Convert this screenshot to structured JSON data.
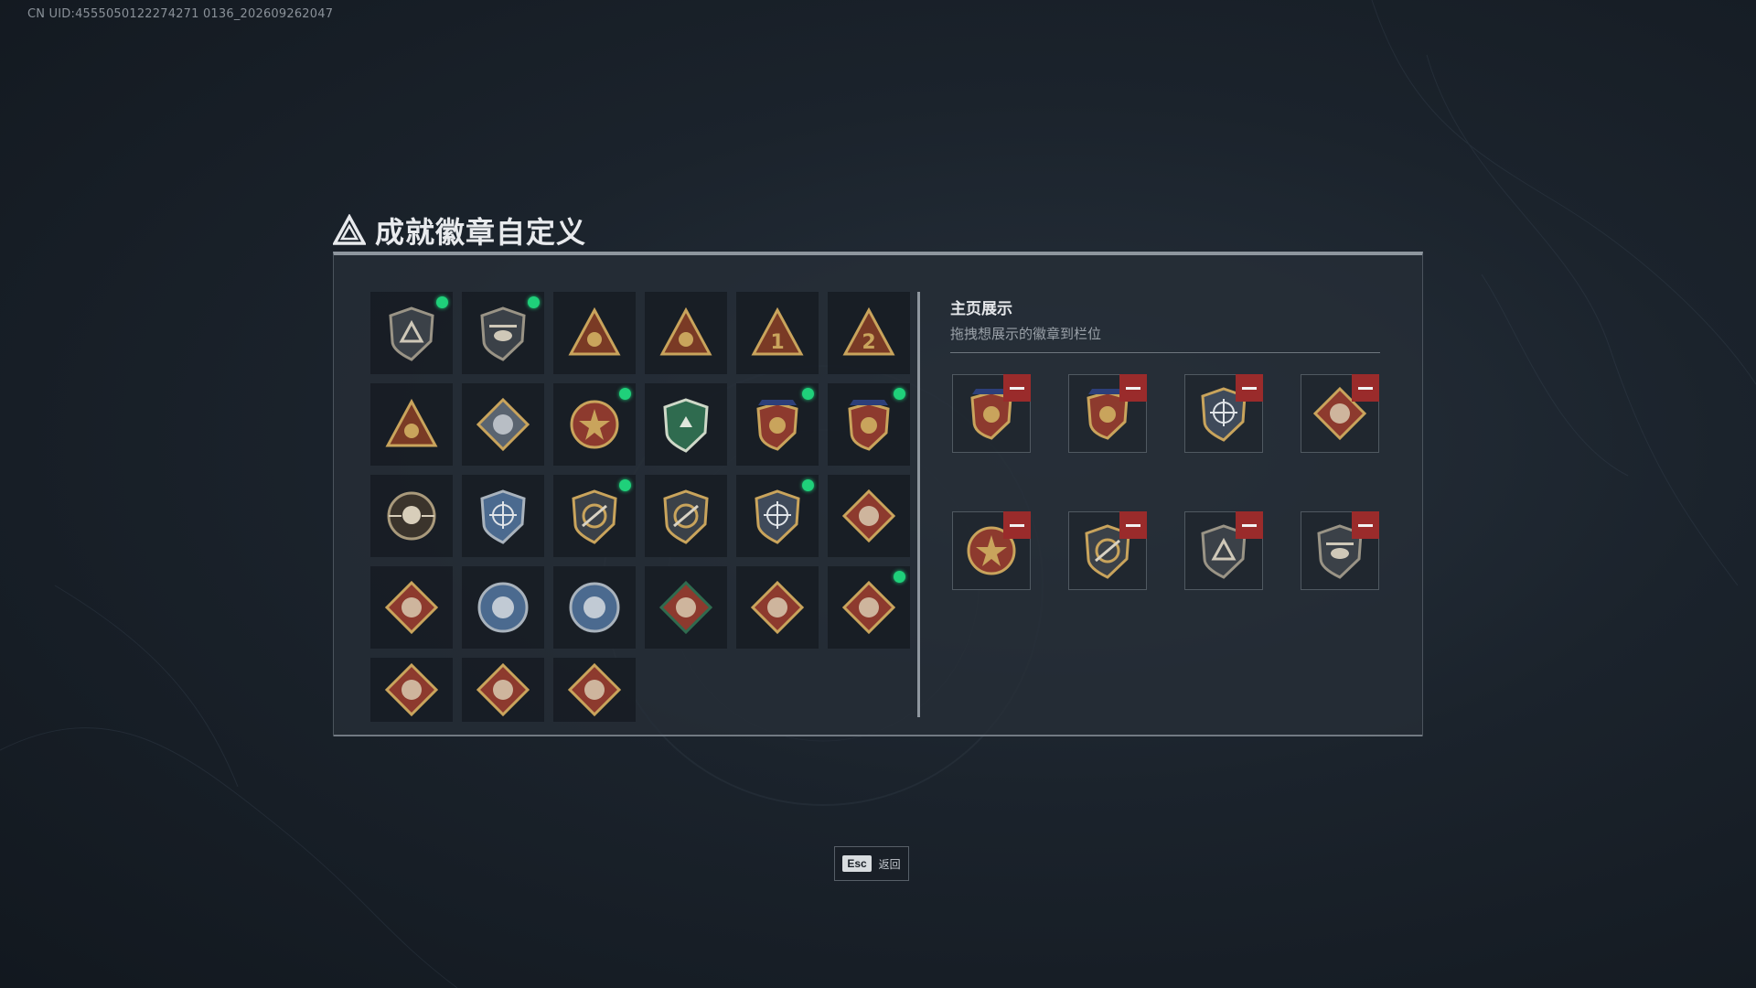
{
  "uid_text": "CN UID:4555050122274271 0136_202609262047",
  "title": "成就徽章自定义",
  "showcase": {
    "title": "主页展示",
    "subtitle": "拖拽想展示的徽章到栏位"
  },
  "esc": {
    "key": "Esc",
    "label": "返回"
  },
  "colors": {
    "accent_green": "#1fd07a",
    "remove_red": "#9a2b2b",
    "gold": "#c9a45c",
    "crimson": "#8d3a2e",
    "steel_blue": "#4b6a8f",
    "green_shield": "#2f6b4f"
  },
  "badges": [
    {
      "icon": "triangle-shield-icon",
      "new": true
    },
    {
      "icon": "helicopter-shield-icon",
      "new": true
    },
    {
      "icon": "hand-triangle-icon",
      "new": false
    },
    {
      "icon": "boat-triangle-icon",
      "new": false
    },
    {
      "icon": "number-1-triangle-icon",
      "new": false
    },
    {
      "icon": "number-2-triangle-icon",
      "new": false
    },
    {
      "icon": "squad-triangle-icon",
      "new": false
    },
    {
      "icon": "cube-diamond-icon",
      "new": false
    },
    {
      "icon": "star-emblem-icon",
      "new": true
    },
    {
      "icon": "green-shield-icon",
      "new": false
    },
    {
      "icon": "laurel-crest-icon",
      "new": true
    },
    {
      "icon": "crest-shield-icon",
      "new": true
    },
    {
      "icon": "skull-scope-icon",
      "new": false
    },
    {
      "icon": "blue-crosshair-icon",
      "new": false
    },
    {
      "icon": "rifle-shield-icon",
      "new": true
    },
    {
      "icon": "rifle-shield-plain-icon",
      "new": false
    },
    {
      "icon": "gold-crosshair-icon",
      "new": true
    },
    {
      "icon": "wolf-diamond-icon",
      "new": false
    },
    {
      "icon": "wolf-diamond-alt-icon",
      "new": false
    },
    {
      "icon": "wolf-circle-icon",
      "new": false
    },
    {
      "icon": "eagle-circle-icon",
      "new": false
    },
    {
      "icon": "dragon-diamond-green-icon",
      "new": false
    },
    {
      "icon": "dragon-diamond-icon",
      "new": false
    },
    {
      "icon": "dragon-diamond-alt-icon",
      "new": true
    },
    {
      "icon": "runner-diamond-icon",
      "new": false
    },
    {
      "icon": "horse-diamond-icon",
      "new": false
    },
    {
      "icon": "anchor-diamond-icon",
      "new": false
    }
  ],
  "slots": [
    {
      "icon": "laurel-crest-icon"
    },
    {
      "icon": "crest-shield-icon"
    },
    {
      "icon": "gold-crosshair-icon"
    },
    {
      "icon": "dragon-diamond-icon"
    },
    {
      "icon": "star-emblem-icon"
    },
    {
      "icon": "rifle-shield-icon"
    },
    {
      "icon": "triangle-shield-icon"
    },
    {
      "icon": "helicopter-shield-icon"
    }
  ]
}
